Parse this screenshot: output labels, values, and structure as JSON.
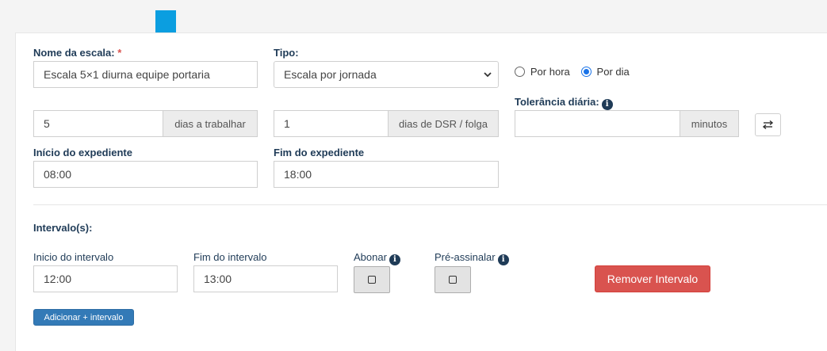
{
  "colors": {
    "arrow": "#0b9ee0",
    "label": "#1f3b57",
    "required": "#d9534f",
    "danger": "#d9534f",
    "primary": "#337ab7",
    "radio_checked": "#1a73e8"
  },
  "form": {
    "nome": {
      "label": "Nome da escala:",
      "required_mark": "*",
      "value": "Escala 5×1 diurna equipe portaria"
    },
    "tipo": {
      "label": "Tipo:",
      "value": "Escala por jornada"
    },
    "radios": {
      "por_hora": "Por hora",
      "por_dia": "Por dia",
      "selected": "por_dia"
    },
    "dias_trabalhar": {
      "value": "5",
      "addon": "dias a trabalhar"
    },
    "dias_dsr": {
      "value": "1",
      "addon": "dias de DSR / folga"
    },
    "tolerancia": {
      "label": "Tolerância diária:",
      "value": "",
      "addon": "minutos"
    },
    "inicio_expediente": {
      "label": "Início do expediente",
      "value": "08:00"
    },
    "fim_expediente": {
      "label": "Fim do expediente",
      "value": "18:00"
    }
  },
  "intervalos": {
    "title": "Intervalo(s):",
    "inicio": {
      "label": "Inicio do intervalo",
      "value": "12:00"
    },
    "fim": {
      "label": "Fim do intervalo",
      "value": "13:00"
    },
    "abonar_label": "Abonar",
    "pre_assinalar_label": "Pré-assinalar",
    "remover_label": "Remover Intervalo",
    "adicionar_label": "Adicionar + intervalo"
  },
  "icons": {
    "arrow": "arrow-down-icon",
    "info": "info-circle-icon",
    "swap": "exchange-icon",
    "select": "chevron-down-icon",
    "checkbox": "square-icon"
  }
}
